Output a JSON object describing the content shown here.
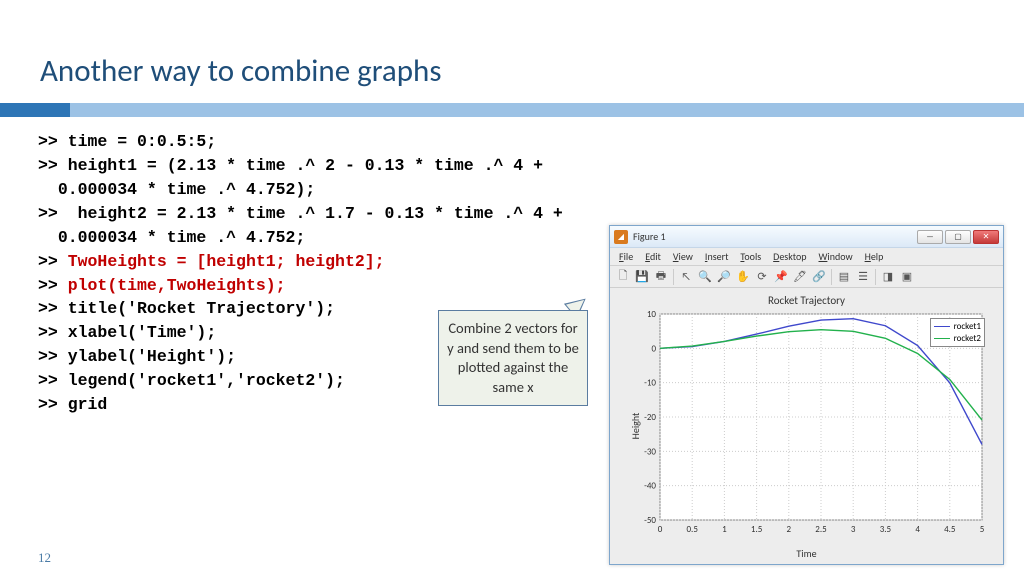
{
  "title": "Another way to combine graphs",
  "page_number": "12",
  "code": {
    "l1": ">> time = 0:0.5:5;",
    "l2": ">> height1 = (2.13 * time .^ 2 - 0.13 * time .^ 4 +\n  0.000034 * time .^ 4.752);",
    "l3": ">>  height2 = 2.13 * time .^ 1.7 - 0.13 * time .^ 4 +\n  0.000034 * time .^ 4.752;",
    "l4a": ">> ",
    "l4b": "TwoHeights = [height1; height2];",
    "l5a": ">> ",
    "l5b": "plot(time,TwoHeights);",
    "l6": ">> title('Rocket Trajectory');",
    "l7": ">> xlabel('Time');",
    "l8": ">> ylabel('Height');",
    "l9": ">> legend('rocket1','rocket2');",
    "l10": ">> grid"
  },
  "callout": "Combine 2 vectors for y and send them to be plotted against the same x",
  "figure": {
    "window_title": "Figure 1",
    "menus": [
      "File",
      "Edit",
      "View",
      "Insert",
      "Tools",
      "Desktop",
      "Window",
      "Help"
    ],
    "plot_title": "Rocket Trajectory",
    "xlabel": "Time",
    "ylabel": "Height",
    "legend": [
      "rocket1",
      "rocket2"
    ],
    "xticks": [
      "0",
      "0.5",
      "1",
      "1.5",
      "2",
      "2.5",
      "3",
      "3.5",
      "4",
      "4.5",
      "5"
    ],
    "yticks": [
      "-50",
      "-40",
      "-30",
      "-20",
      "-10",
      "0",
      "10"
    ]
  },
  "chart_data": {
    "type": "line",
    "title": "Rocket Trajectory",
    "xlabel": "Time",
    "ylabel": "Height",
    "xlim": [
      0,
      5
    ],
    "ylim": [
      -50,
      10
    ],
    "x": [
      0,
      0.5,
      1,
      1.5,
      2,
      2.5,
      3,
      3.5,
      4,
      4.5,
      5
    ],
    "series": [
      {
        "name": "rocket1",
        "color": "#3f48cc",
        "values": [
          0,
          0.52,
          2.0,
          4.14,
          6.44,
          8.24,
          8.64,
          6.58,
          0.8,
          -10.06,
          -28.0
        ]
      },
      {
        "name": "rocket2",
        "color": "#22b14c",
        "values": [
          0,
          0.65,
          2.0,
          3.56,
          4.84,
          5.44,
          4.95,
          2.93,
          -1.49,
          -9.07,
          -20.88
        ]
      }
    ],
    "legend_position": "upper right",
    "grid": true
  }
}
